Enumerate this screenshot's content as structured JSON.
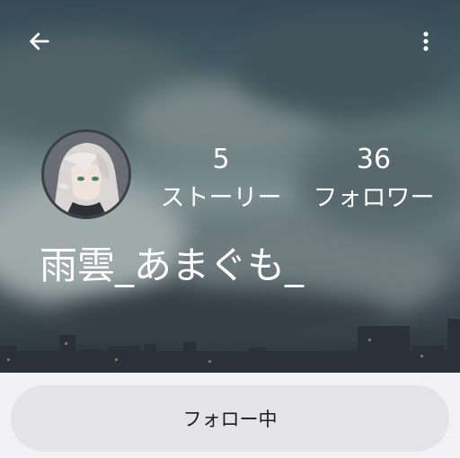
{
  "header": {
    "back_icon": "arrow-left-icon",
    "more_icon": "more-vertical-icon"
  },
  "profile": {
    "avatar_icon": "avatar-illustration",
    "stats": [
      {
        "value": "5",
        "label": "ストーリー"
      },
      {
        "value": "36",
        "label": "フォロワー"
      }
    ],
    "name": "雨雲_あまぐも_"
  },
  "actions": {
    "follow_label": "フォロー中"
  },
  "colors": {
    "text": "#ffffff",
    "button_bg": "#e4e4e8",
    "page_bg": "#f2f2f4"
  }
}
